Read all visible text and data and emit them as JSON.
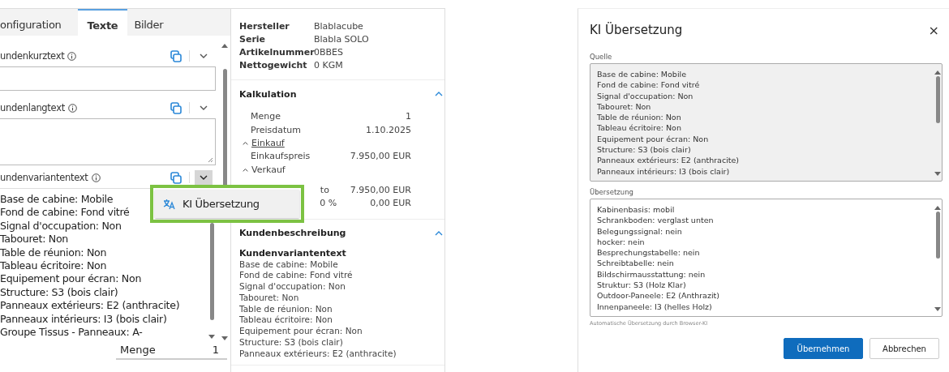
{
  "editor": {
    "tabs": [
      {
        "label": "onfiguration",
        "selected": false
      },
      {
        "label": "Texte",
        "selected": true
      },
      {
        "label": "Bilder",
        "selected": false
      }
    ],
    "fields": [
      {
        "kind": "input",
        "label": "undenkurztext",
        "menu_open": false
      },
      {
        "kind": "textarea",
        "label": "undenlangtext",
        "menu_open": false
      },
      {
        "kind": "list",
        "label": "undenvariantentext",
        "menu_open": true,
        "lines": [
          "Base de cabine: Mobile",
          "Fond de cabine: Fond vitré",
          "Signal d'occupation: Non",
          "Tabouret: Non",
          "Table de réunion: Non",
          "Tableau écritoire: Non",
          "Equipement pour écran: Non",
          "Structure: S3 (bois clair)",
          "Panneaux extérieurs: E2 (anthracite)",
          "Panneaux intérieurs: I3 (bois clair)",
          "Groupe Tissus - Panneaux: A-"
        ]
      }
    ],
    "menu": {
      "items": [
        {
          "label": "KI Übersetzung"
        }
      ]
    },
    "quantity": {
      "label": "Menge",
      "value": "1"
    }
  },
  "details": {
    "attributes": [
      {
        "label": "Hersteller",
        "value": "Blablacube"
      },
      {
        "label": "Serie",
        "value": "Blabla SOLO"
      },
      {
        "label": "Artikelnummer",
        "value": "0BBES"
      },
      {
        "label": "Nettogewicht",
        "value": "0 KGM"
      }
    ],
    "sections": [
      {
        "title": "Kalkulation",
        "expanded": true,
        "kind": "calc",
        "rows": [
          {
            "label": "Menge",
            "value": "1"
          },
          {
            "label": "Preisdatum",
            "value": "1.10.2025"
          }
        ],
        "groups": [
          {
            "title": "Einkauf",
            "expanded": true,
            "focused": true,
            "rows": [
              {
                "label": "Einkaufspreis",
                "value": "7.950,00 EUR"
              }
            ]
          },
          {
            "title": "Verkauf",
            "expanded": true,
            "focused": false,
            "rows": [
              {
                "label_end": "to",
                "value": "7.950,00 EUR"
              },
              {
                "percent": "0 %",
                "value": "0,00 EUR"
              }
            ]
          }
        ]
      },
      {
        "title": "Kundenbeschreibung",
        "expanded": true,
        "kind": "text",
        "subtitle": "Kundenvariantentext",
        "lines": [
          "Base de cabine: Mobile",
          "Fond de cabine: Fond vitré",
          "Signal d'occupation: Non",
          "Tabouret: Non",
          "Table de réunion: Non",
          "Tableau écritoire: Non",
          "Equipement pour écran: Non",
          "Structure: S3 (bois clair)",
          "Panneaux extérieurs: E2 (anthracite)"
        ]
      }
    ]
  },
  "dialog": {
    "title": "KI Übersetzung",
    "close": "×",
    "source": {
      "label": "Quelle",
      "readonly": true,
      "lines": [
        "Base de cabine: Mobile",
        "Fond de cabine: Fond vitré",
        "Signal d'occupation: Non",
        "Tabouret: Non",
        "Table de réunion: Non",
        "Tableau écritoire: Non",
        "Equipement pour écran: Non",
        "Structure: S3 (bois clair)",
        "Panneaux extérieurs: E2 (anthracite)",
        "Panneaux intérieurs: I3 (bois clair)"
      ]
    },
    "target": {
      "label": "Übersetzung",
      "readonly": false,
      "lines": [
        "Kabinenbasis: mobil",
        "Schrankboden: verglast unten",
        "Belegungssignal: nein",
        "hocker: nein",
        "Besprechungstabelle: nein",
        "Schreibtabelle: nein",
        "Bildschirmausstattung: nein",
        "Struktur: S3 (Holz Klar)",
        "Outdoor-Paneele: E2 (Anthrazit)",
        "Innenpaneele: I3 (helles Holz)"
      ]
    },
    "note": "Automatische Übersetzung durch Browser-KI",
    "buttons": [
      {
        "label": "Übernehmen",
        "kind": "primary"
      },
      {
        "label": "Abbrechen",
        "kind": "secondary"
      }
    ]
  }
}
